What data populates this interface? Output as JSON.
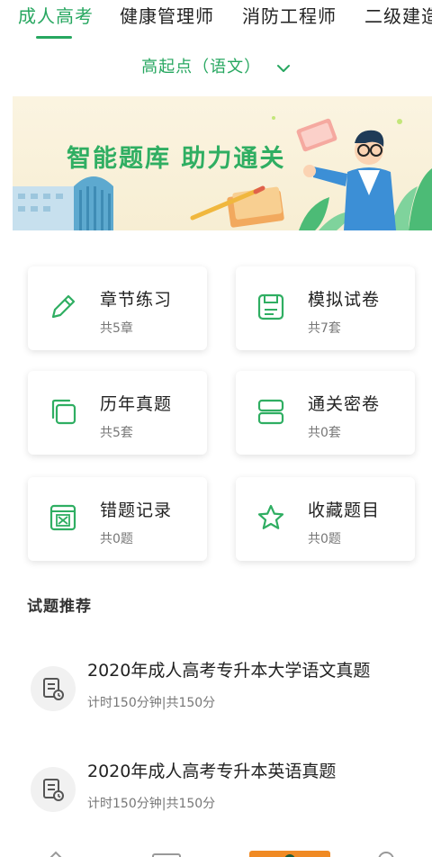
{
  "tabs": [
    {
      "label": "成人高考",
      "active": true
    },
    {
      "label": "健康管理师",
      "active": false
    },
    {
      "label": "消防工程师",
      "active": false
    },
    {
      "label": "二级建造",
      "active": false
    }
  ],
  "subject_selector": {
    "label": "高起点（语文）",
    "icon": "chevron-down-icon"
  },
  "banner": {
    "slogan": "智能题库  助力通关"
  },
  "modules": [
    {
      "title": "章节练习",
      "sub": "共5章",
      "icon": "pencil-icon"
    },
    {
      "title": "模拟试卷",
      "sub": "共7套",
      "icon": "save-disk-icon"
    },
    {
      "title": "历年真题",
      "sub": "共5套",
      "icon": "copy-icon"
    },
    {
      "title": "通关密卷",
      "sub": "共0套",
      "icon": "stack-icon"
    },
    {
      "title": "错题记录",
      "sub": "共0题",
      "icon": "wrong-record-icon"
    },
    {
      "title": "收藏题目",
      "sub": "共0题",
      "icon": "star-icon"
    }
  ],
  "recommend": {
    "title": "试题推荐",
    "items": [
      {
        "title": "2020年成人高考专升本大学语文真题",
        "meta": "计时150分钟|共150分",
        "icon": "exam-paper-icon"
      },
      {
        "title": "2020年成人高考专升本英语真题",
        "meta": "计时150分钟|共150分",
        "icon": "exam-paper-icon"
      }
    ]
  },
  "colors": {
    "accent": "#27a760",
    "banner_bg": "#fbf4e1"
  }
}
